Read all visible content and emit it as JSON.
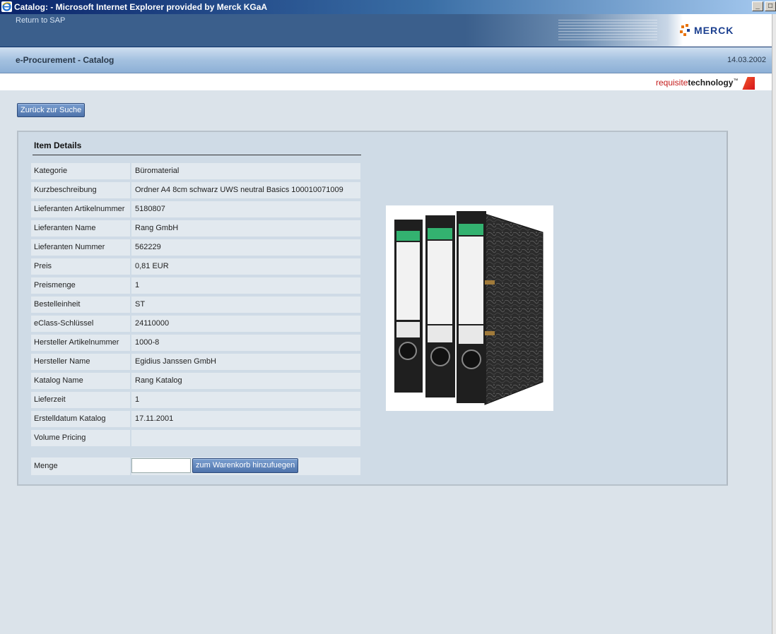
{
  "window": {
    "title": "Catalog: - Microsoft Internet Explorer provided by Merck KGaA",
    "minimize": "_",
    "maximize": "□"
  },
  "sapbar": {
    "return_label": "Return to SAP",
    "logo_text": "MERCK"
  },
  "header": {
    "title": "e-Procurement - Catalog",
    "date": "14.03.2002"
  },
  "branding": {
    "req_part1": "requisite",
    "req_part2": "technology",
    "tm": "™"
  },
  "content": {
    "back_button": "Zurück zur Suche",
    "panel_title": "Item Details",
    "rows": [
      {
        "label": "Kategorie",
        "value": "Büromaterial"
      },
      {
        "label": "Kurzbeschreibung",
        "value": "Ordner A4 8cm schwarz UWS neutral Basics 100010071009"
      },
      {
        "label": "Lieferanten Artikelnummer",
        "value": "5180807"
      },
      {
        "label": "Lieferanten Name",
        "value": "Rang GmbH"
      },
      {
        "label": "Lieferanten Nummer",
        "value": "562229"
      },
      {
        "label": "Preis",
        "value": "0,81 EUR"
      },
      {
        "label": "Preismenge",
        "value": "1"
      },
      {
        "label": "Bestelleinheit",
        "value": "ST"
      },
      {
        "label": "eClass-Schlüssel",
        "value": "24110000"
      },
      {
        "label": "Hersteller Artikelnummer",
        "value": "1000-8"
      },
      {
        "label": "Hersteller Name",
        "value": "Egidius Janssen GmbH"
      },
      {
        "label": "Katalog Name",
        "value": "Rang Katalog"
      },
      {
        "label": "Lieferzeit",
        "value": "1"
      },
      {
        "label": "Erstelldatum Katalog",
        "value": "17.11.2001"
      },
      {
        "label": "Volume Pricing",
        "value": ""
      }
    ],
    "quantity_label": "Menge",
    "quantity_value": "",
    "add_to_cart": "zum Warenkorb hinzufuegen"
  }
}
